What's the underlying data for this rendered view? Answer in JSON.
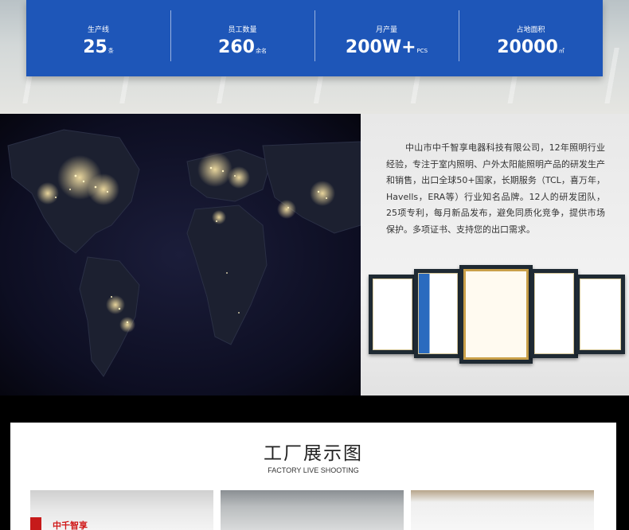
{
  "stats": [
    {
      "label": "生产线",
      "value": "25",
      "unit": "条"
    },
    {
      "label": "员工数量",
      "value": "260",
      "unit": "余名"
    },
    {
      "label": "月产量",
      "value": "200W+",
      "unit": "PCS"
    },
    {
      "label": "占地面积",
      "value": "20000",
      "unit": "㎡"
    }
  ],
  "company": {
    "description": "中山市中千智享电器科技有限公司，12年照明行业经验，专注于室内照明、户外太阳能照明产品的研发生产和销售，出口全球50+国家，长期服务（TCL，喜万年，Havells，ERA等）行业知名品牌。12人的研发团队，25项专利，每月新品发布，避免同质化竞争，提供市场保护。多项证书、支持您的出口需求。"
  },
  "factory": {
    "title": "工厂展示图",
    "subtitle": "FACTORY LIVE SHOOTING",
    "photo1_brand": "中千智享"
  },
  "colors": {
    "stats_bg": "#1e56b8",
    "map_bg": "#0d0e22"
  }
}
